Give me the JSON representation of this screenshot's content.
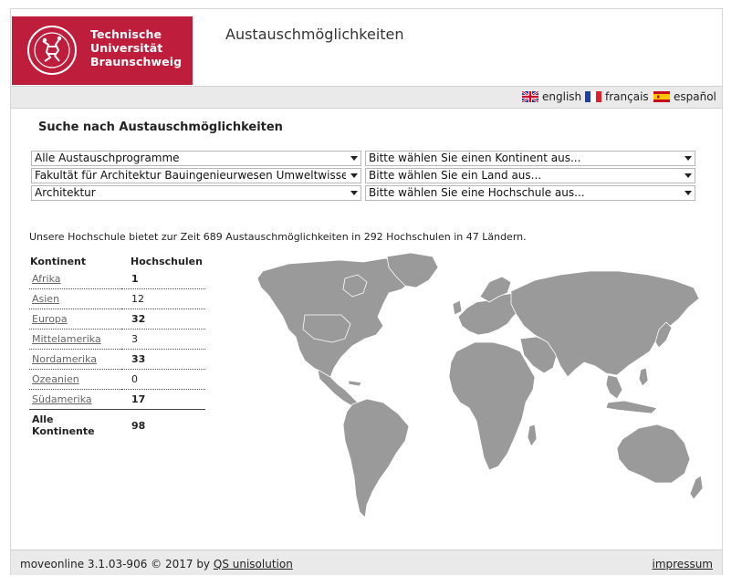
{
  "logo": {
    "line1": "Technische",
    "line2": "Universität",
    "line3": "Braunschweig"
  },
  "app_title": "Austauschmöglichkeiten",
  "languages": [
    {
      "label": "english",
      "flag": "uk-flag-icon"
    },
    {
      "label": "français",
      "flag": "fr-flag-icon"
    },
    {
      "label": "español",
      "flag": "es-flag-icon"
    }
  ],
  "search": {
    "heading": "Suche nach Austauschmöglichkeiten",
    "program": "Alle Austauschprogramme",
    "faculty": "Fakultät für Architektur Bauingenieurwesen Umweltwissenschaften",
    "subject": "Architektur",
    "continent": "Bitte wählen Sie einen Kontinent aus...",
    "country": "Bitte wählen Sie ein Land aus...",
    "university": "Bitte wählen Sie eine Hochschule aus..."
  },
  "summary": "Unsere Hochschule bietet zur Zeit 689 Austauschmöglichkeiten in 292 Hochschulen in 47 Ländern.",
  "table": {
    "col1": "Kontinent",
    "col2": "Hochschulen",
    "rows": [
      {
        "name": "Afrika",
        "count": "1"
      },
      {
        "name": "Asien",
        "count": "12"
      },
      {
        "name": "Europa",
        "count": "32"
      },
      {
        "name": "Mittelamerika",
        "count": "3"
      },
      {
        "name": "Nordamerika",
        "count": "33"
      },
      {
        "name": "Ozeanien",
        "count": "0"
      },
      {
        "name": "Südamerika",
        "count": "17"
      }
    ],
    "total_label": "Alle Kontinente",
    "total_count": "98"
  },
  "footer": {
    "copy": "moveonline 3.1.03-906 © 2017 by",
    "vendor": "QS unisolution",
    "impressum": "impressum"
  },
  "colors": {
    "brand": "#be1e3c",
    "map_fill": "#9a9a9a",
    "bar": "#eaeaea"
  }
}
